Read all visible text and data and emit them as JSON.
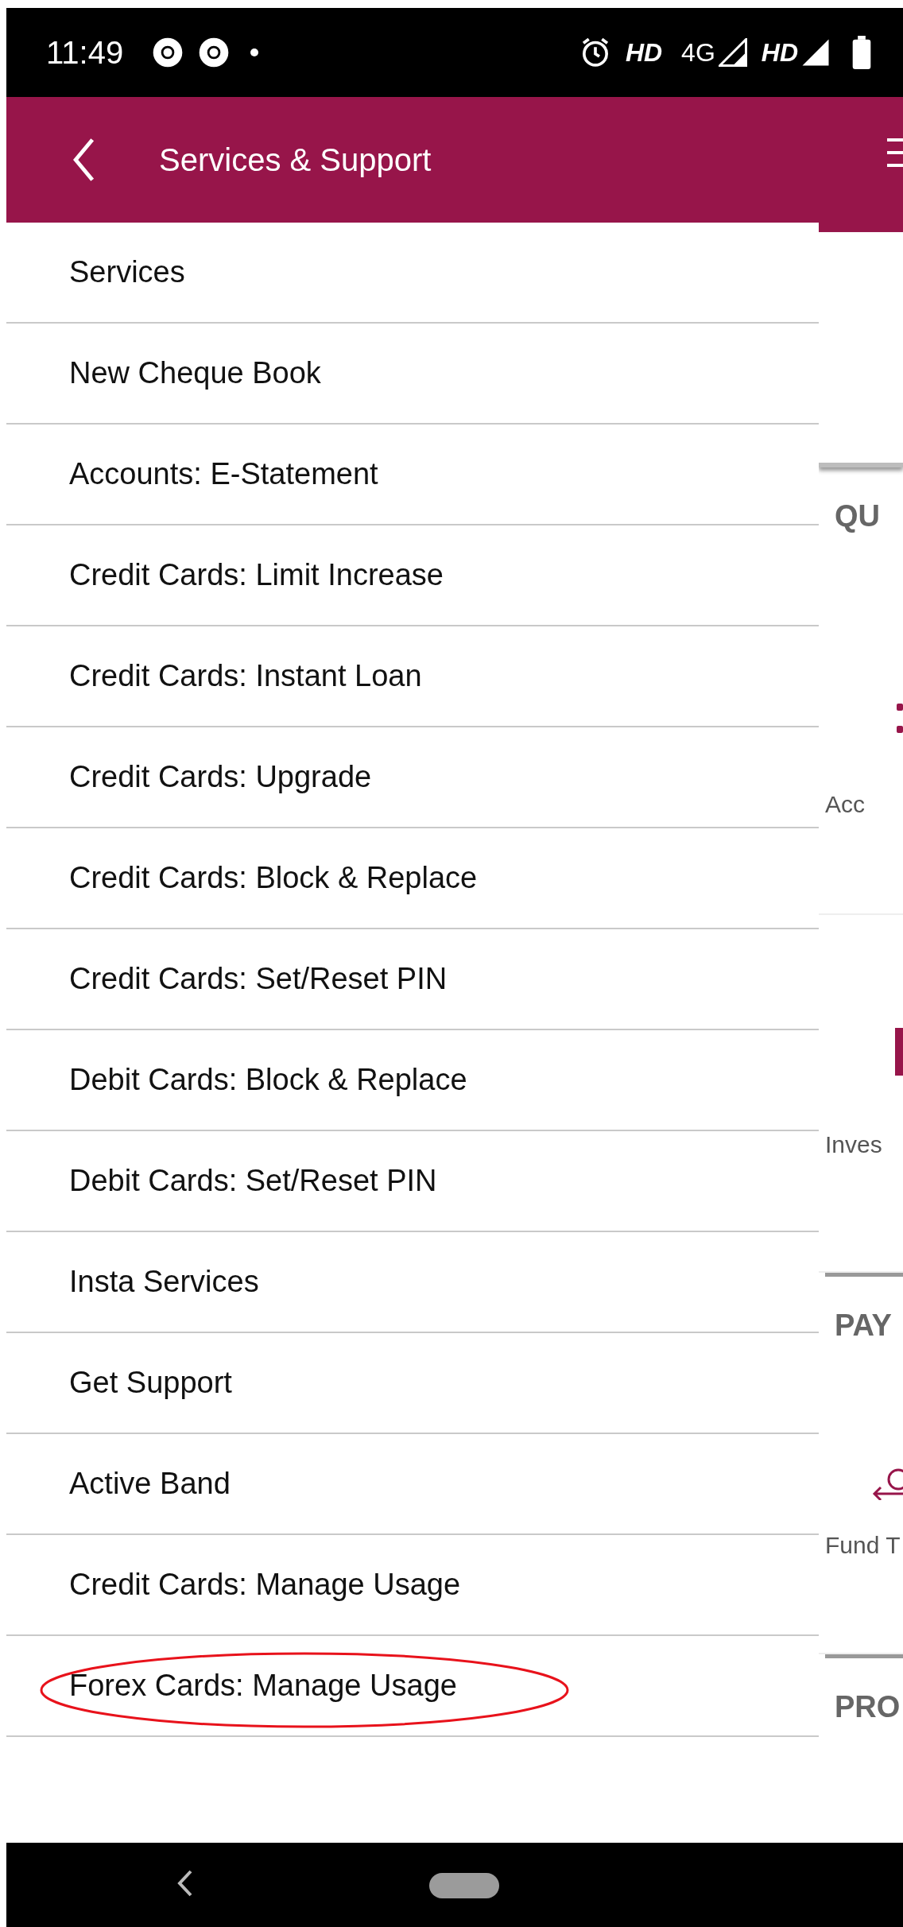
{
  "status_bar": {
    "time": "11:49",
    "network_labels": [
      "HD",
      "4G",
      "HD"
    ]
  },
  "header": {
    "title": "Services & Support"
  },
  "menu_items": [
    {
      "label": "Services",
      "highlighted": false
    },
    {
      "label": "New Cheque Book",
      "highlighted": false
    },
    {
      "label": "Accounts: E-Statement",
      "highlighted": false
    },
    {
      "label": "Credit Cards: Limit Increase",
      "highlighted": false
    },
    {
      "label": "Credit Cards: Instant Loan",
      "highlighted": false
    },
    {
      "label": "Credit Cards: Upgrade",
      "highlighted": false
    },
    {
      "label": "Credit Cards: Block & Replace",
      "highlighted": false
    },
    {
      "label": "Credit Cards: Set/Reset PIN",
      "highlighted": false
    },
    {
      "label": "Debit Cards: Block & Replace",
      "highlighted": false
    },
    {
      "label": "Debit Cards: Set/Reset PIN",
      "highlighted": false
    },
    {
      "label": "Insta Services",
      "highlighted": false
    },
    {
      "label": "Get Support",
      "highlighted": false
    },
    {
      "label": "Active Band",
      "highlighted": false
    },
    {
      "label": "Credit Cards: Manage Usage",
      "highlighted": false
    },
    {
      "label": "Forex Cards: Manage Usage",
      "highlighted": true
    }
  ],
  "background_page": {
    "section_headings": [
      "QU",
      "PAY",
      "PRO"
    ],
    "tile_labels": [
      "Acc",
      "Inves",
      "Fund T"
    ]
  }
}
